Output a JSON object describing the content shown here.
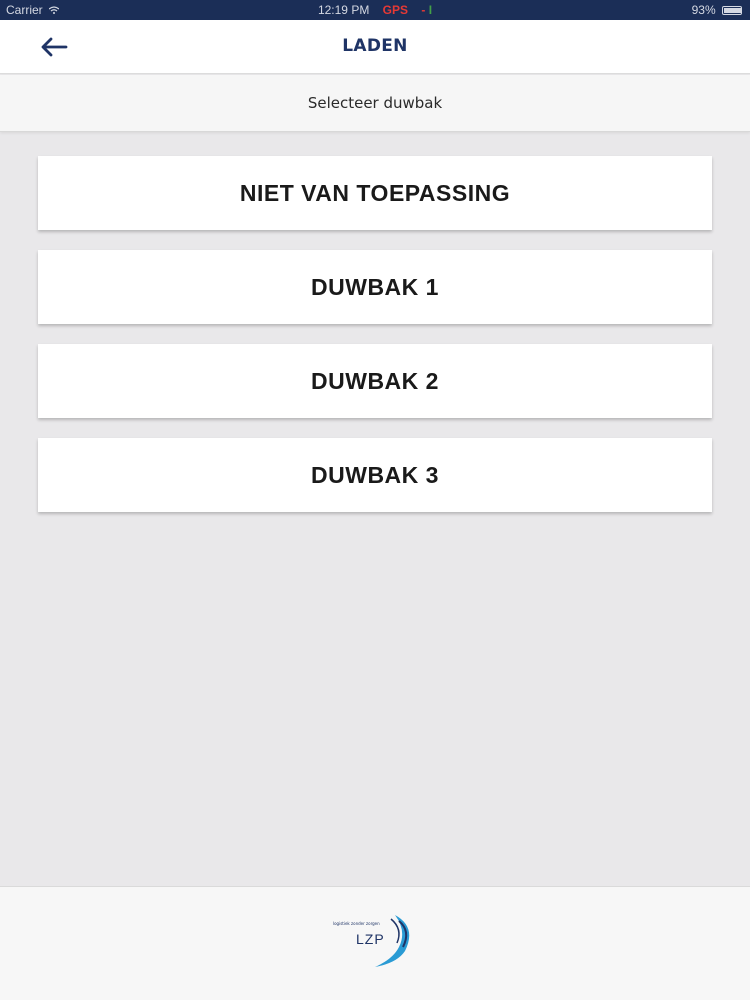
{
  "status_bar": {
    "carrier": "Carrier",
    "time": "12:19 PM",
    "gps_label": "GPS",
    "gps_separator": "-",
    "gps_signal": "I",
    "battery": "93%"
  },
  "nav": {
    "title": "LADEN",
    "back_icon": "arrow-left-icon"
  },
  "sub_header": {
    "text": "Selecteer duwbak"
  },
  "options": [
    {
      "label": "NIET VAN TOEPASSING"
    },
    {
      "label": "DUWBAK 1"
    },
    {
      "label": "DUWBAK 2"
    },
    {
      "label": "DUWBAK 3"
    }
  ],
  "footer": {
    "logo_text": "LZP",
    "logo_tagline": "logistiek zonder zorgen"
  },
  "colors": {
    "brand_navy": "#1f3466",
    "status_bar": "#1b2e57",
    "gps_red": "#e53935",
    "gps_green": "#43a047",
    "logo_blue": "#2a9bd4"
  }
}
